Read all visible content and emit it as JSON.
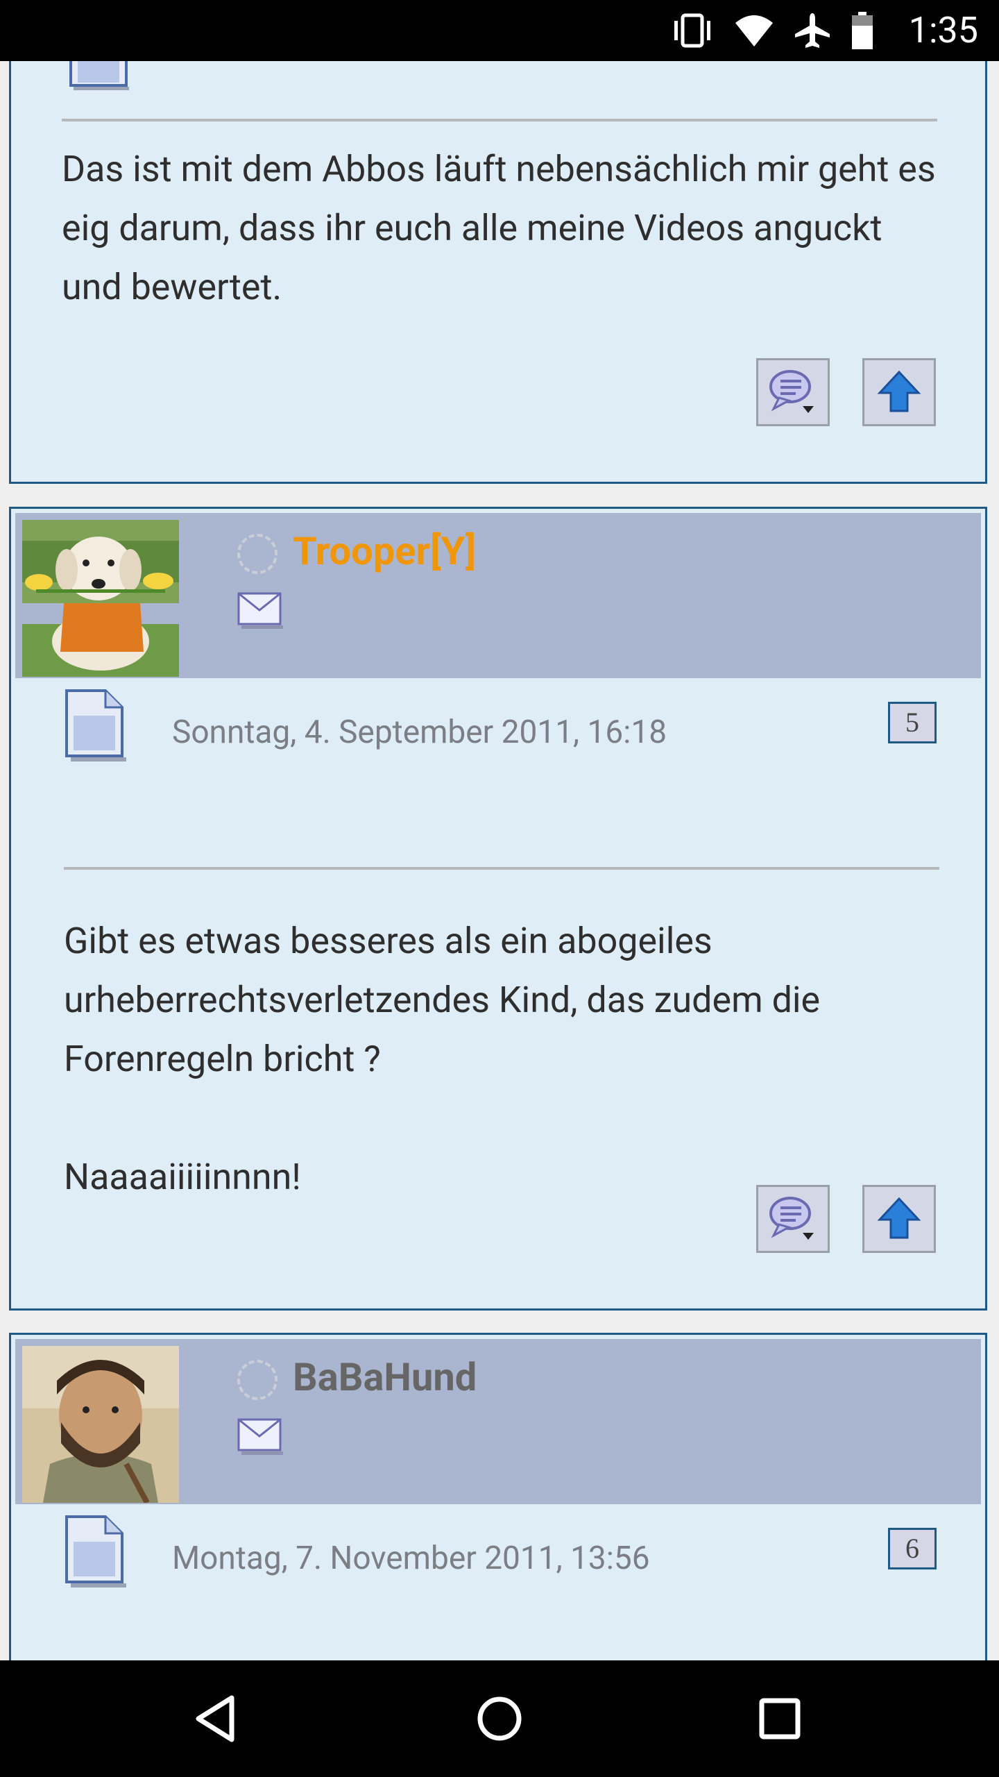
{
  "status_bar": {
    "time": "1:35",
    "icons": [
      "vibrate-icon",
      "wifi-icon",
      "airplane-mode-icon",
      "battery-icon"
    ]
  },
  "posts": [
    {
      "body": [
        "Das ist mit dem Abbos läuft nebensächlich mir geht es eig darum, dass ihr euch alle meine Videos anguckt und bewertet."
      ]
    },
    {
      "username": "Trooper[Y]",
      "username_color": "#f0960a",
      "date": "Sonntag, 4. September 2011, 16:18",
      "number": "5",
      "body": [
        "Gibt es etwas besseres als ein abogeiles urheberrechtsverletzendes Kind, das zudem die Forenregeln bricht ?",
        "",
        "Naaaaiiiiinnnn!"
      ]
    },
    {
      "username": "BaBaHund",
      "username_color": "#666666",
      "date": "Montag, 7. November 2011, 13:56",
      "number": "6"
    }
  ],
  "colors": {
    "post_background": "#deedf6",
    "post_header": "#aab6d0",
    "post_border": "#1f5a86"
  },
  "nav_bar": {
    "buttons": [
      "back-icon",
      "home-icon",
      "recents-icon"
    ]
  }
}
